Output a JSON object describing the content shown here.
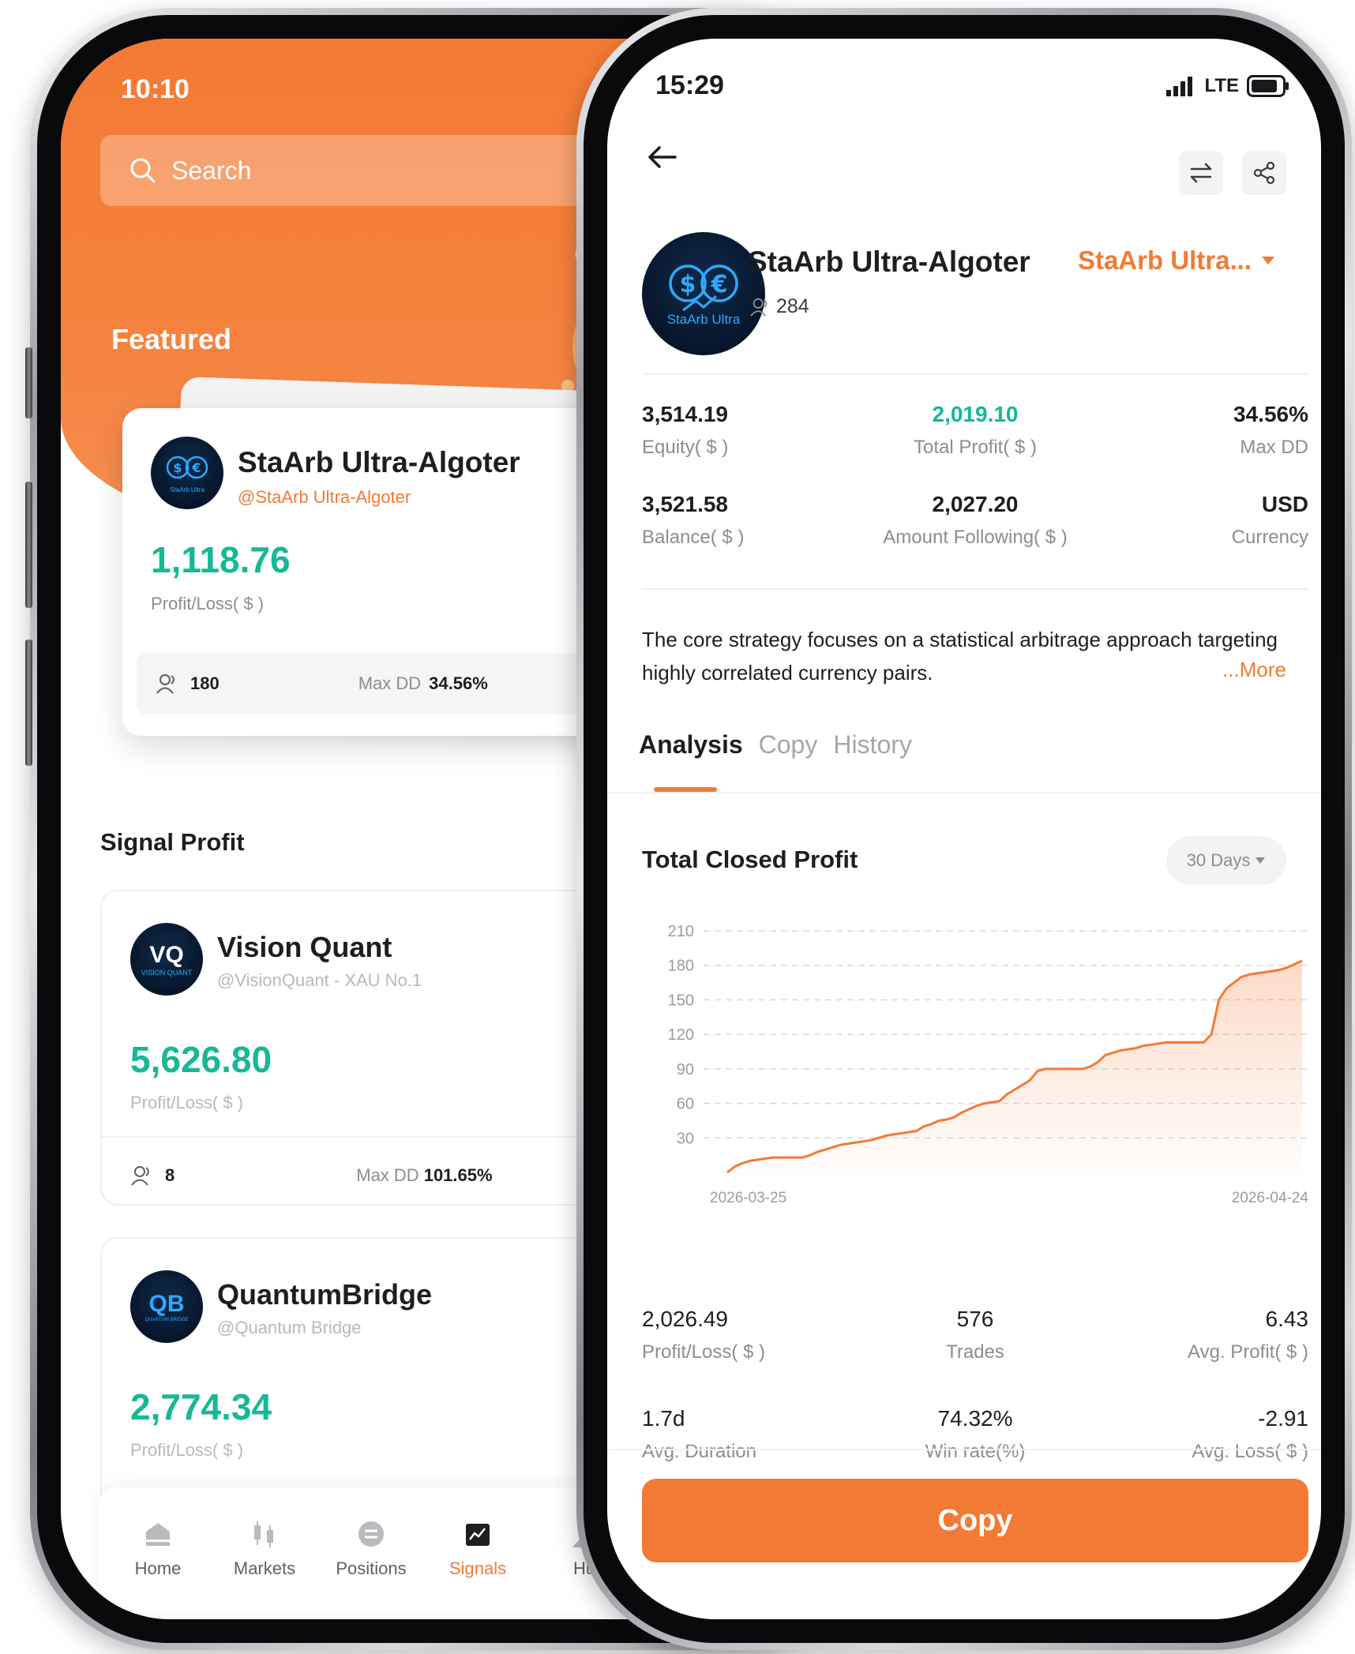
{
  "left_phone": {
    "status_time": "10:10",
    "search_placeholder": "Search",
    "featured_title": "Featured",
    "featured_card": {
      "avatar_text": "StaArb Ultra",
      "name": "StaArb Ultra-Algoter",
      "handle": "@StaArb Ultra-Algoter",
      "value": "1,118.76",
      "value_label": "Profit/Loss( $ )",
      "followers": "180",
      "max_dd_label": "Max DD",
      "max_dd_value": "34.56%"
    },
    "signal_profit_title": "Signal Profit",
    "signals": [
      {
        "avatar_text": "VQ",
        "avatar_subtext": "VISION QUANT",
        "name": "Vision Quant",
        "handle": "@VisionQuant - XAU No.1",
        "value": "5,626.80",
        "value_label": "Profit/Loss( $ )",
        "followers": "8",
        "max_dd_label": "Max DD",
        "max_dd_value": "101.65%"
      },
      {
        "avatar_text": "QB",
        "avatar_subtext": "QUANTUM BRIDGE",
        "name": "QuantumBridge",
        "handle": "@Quantum Bridge",
        "value": "2,774.34",
        "value_label": "Profit/Loss( $ )"
      }
    ],
    "tab_bar": [
      {
        "label": "Home",
        "icon": "home-icon",
        "active": false
      },
      {
        "label": "Markets",
        "icon": "markets-icon",
        "active": false
      },
      {
        "label": "Positions",
        "icon": "positions-icon",
        "active": false
      },
      {
        "label": "Signals",
        "icon": "signals-icon",
        "active": true
      },
      {
        "label": "Hu",
        "icon": "hub-icon",
        "active": false
      }
    ],
    "accent_color": "#f37a35",
    "positive_color": "#16b895"
  },
  "right_phone": {
    "status_time": "15:29",
    "network": "LTE",
    "profile": {
      "avatar_text": "StaArb Ultra",
      "name": "StaArb Ultra-Algoter",
      "followers": "284",
      "account_switch": "StaArb Ultra..."
    },
    "stats": [
      {
        "value": "3,514.19",
        "label": "Equity( $ )"
      },
      {
        "value": "2,019.10",
        "label": "Total Profit( $ )"
      },
      {
        "value": "34.56%",
        "label": "Max DD"
      },
      {
        "value": "3,521.58",
        "label": "Balance( $ )"
      },
      {
        "value": "2,027.20",
        "label": "Amount Following( $ )"
      },
      {
        "value": "USD",
        "label": "Currency"
      }
    ],
    "description": "The core strategy focuses on a statistical arbitrage approach targeting highly correlated currency pairs.",
    "more_link": "...More",
    "tabs": [
      {
        "label": "Analysis",
        "active": true
      },
      {
        "label": "Copy",
        "active": false
      },
      {
        "label": "History",
        "active": false
      }
    ],
    "chart_section_title": "Total Closed Profit",
    "range_selector": "30 Days",
    "summary": [
      {
        "value": "2,026.49",
        "label": "Profit/Loss( $ )"
      },
      {
        "value": "576",
        "label": "Trades"
      },
      {
        "value": "6.43",
        "label": "Avg. Profit( $ )"
      },
      {
        "value": "1.7d",
        "label": "Avg. Duration"
      },
      {
        "value": "74.32%",
        "label": "Win rate(%)"
      },
      {
        "value": "-2.91",
        "label": "Avg. Loss( $ )"
      }
    ],
    "copy_button": "Copy"
  },
  "chart_data": {
    "type": "area",
    "title": "Total Closed Profit",
    "x_ticks": [
      "2026-03-25",
      "2026-04-24"
    ],
    "y_ticks": [
      30,
      60,
      90,
      120,
      150,
      180,
      210
    ],
    "ylim": [
      0,
      210
    ],
    "grid": true,
    "line_color": "#f37a35",
    "series": [
      {
        "values": [
          0,
          5,
          8,
          10,
          11,
          12,
          13,
          13,
          13,
          13,
          13,
          15,
          18,
          20,
          22,
          24,
          25,
          26,
          27,
          28,
          30,
          32,
          33,
          34,
          35,
          36,
          40,
          42,
          45,
          46,
          48,
          52,
          55,
          58,
          60,
          61,
          62,
          68,
          72,
          76,
          80,
          88,
          90,
          90,
          90,
          90,
          90,
          90,
          92,
          96,
          102,
          104,
          106,
          107,
          108,
          110,
          111,
          112,
          113,
          113,
          113,
          113,
          113,
          113,
          120,
          150,
          160,
          165,
          170,
          172,
          173,
          174,
          175,
          176,
          178,
          181,
          184
        ]
      }
    ]
  }
}
